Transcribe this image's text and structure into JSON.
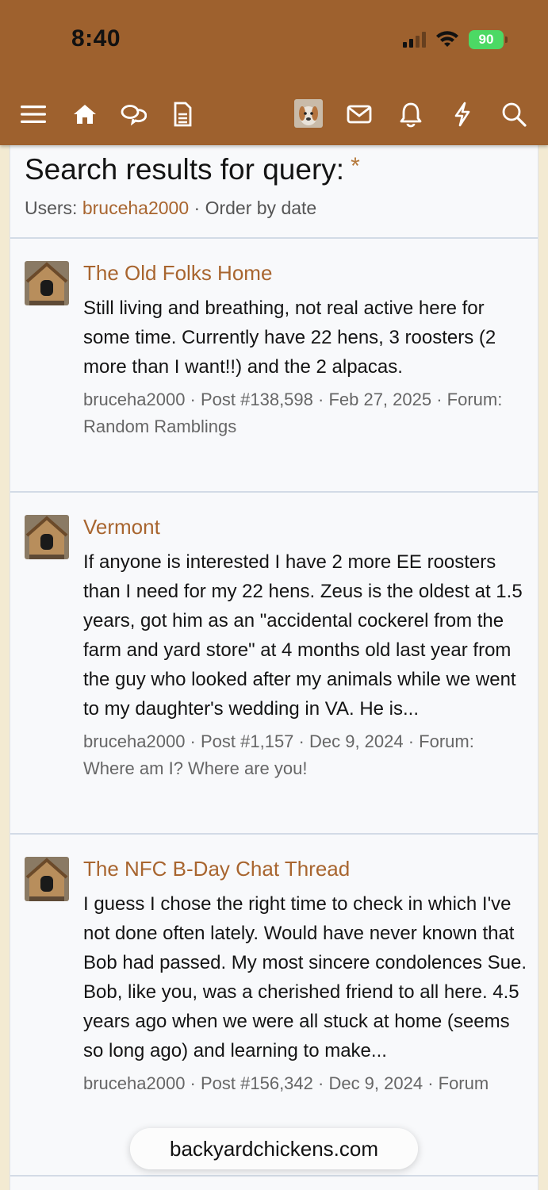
{
  "status_bar": {
    "time": "8:40",
    "battery": "90"
  },
  "nav": {
    "icons": [
      "menu-icon",
      "home-icon",
      "forums-icon",
      "whats-new-icon",
      "user-avatar",
      "inbox-icon",
      "bell-icon",
      "bolt-icon",
      "search-icon"
    ]
  },
  "colors": {
    "topbar": "#9e612e",
    "link": "#a8652f",
    "background": "#f3ead2"
  },
  "search": {
    "title": "Search results for query:",
    "query": "*",
    "users_label": "Users:",
    "user": "bruceha2000",
    "order": "· Order by date"
  },
  "results": [
    {
      "title": "The Old Folks Home",
      "snippet": "Still living and breathing, not real active here for some time. Currently have 22 hens, 3 roosters (2 more than I want!!) and the 2 alpacas.",
      "meta": "bruceha2000 · Post #138,598 · Feb 27, 2025 · Forum: Random Ramblings"
    },
    {
      "title": "Vermont",
      "snippet": "If anyone is interested I have 2 more EE roosters than I need for my 22 hens. Zeus is the oldest at 1.5 years, got him as an \"accidental cockerel from the farm and yard store\" at 4 months old last year from the guy who looked after my animals while we went to my daughter's wedding in VA. He is...",
      "meta": "bruceha2000 · Post #1,157 · Dec 9, 2024 · Forum: Where am I? Where are you!"
    },
    {
      "title": "The NFC B-Day Chat Thread",
      "snippet": "I guess I chose the right time to check in which I've not done often lately. Would have never known that Bob had passed. My most sincere condolences Sue. Bob, like you, was a cherished friend to all here. 4.5 years ago when we were all stuck at home (seems so long ago) and learning to make...",
      "meta": "bruceha2000 · Post #156,342 · Dec 9, 2024 · Forum"
    }
  ],
  "url_bar": {
    "domain": "backyardchickens.com"
  }
}
